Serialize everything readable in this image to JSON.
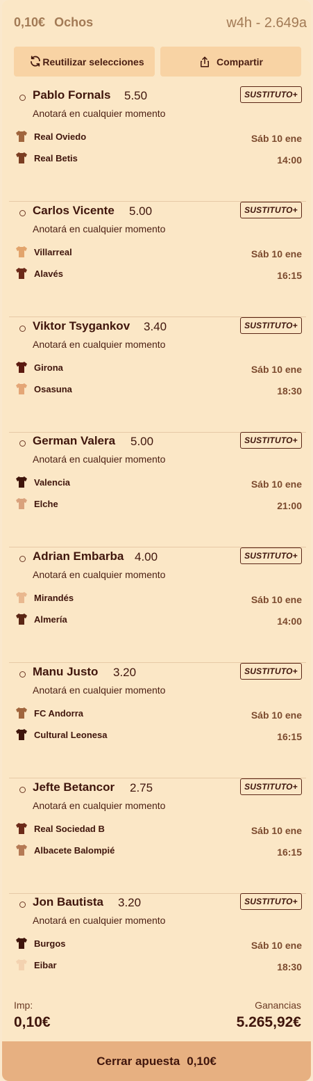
{
  "header": {
    "stake": "0,10€",
    "bet_type": "Ochos",
    "ticket_id": "w4h - 2.649a"
  },
  "actions": {
    "reuse_label": "Reutilizar selecciones",
    "share_label": "Compartir"
  },
  "badge_label": "SUSTITUTO+",
  "legs": [
    {
      "player": "Pablo Fornals",
      "odds": "5.50",
      "market": "Anotará en cualquier momento",
      "home": "Real Oviedo",
      "away": "Real Betis",
      "date": "Sáb 10 ene",
      "time": "14:00"
    },
    {
      "player": "Carlos Vicente",
      "odds": "5.00",
      "market": "Anotará en cualquier momento",
      "home": "Villarreal",
      "away": "Alavés",
      "date": "Sáb 10 ene",
      "time": "16:15"
    },
    {
      "player": "Viktor Tsygankov",
      "odds": "3.40",
      "market": "Anotará en cualquier momento",
      "home": "Girona",
      "away": "Osasuna",
      "date": "Sáb 10 ene",
      "time": "18:30"
    },
    {
      "player": "German Valera",
      "odds": "5.00",
      "market": "Anotará en cualquier momento",
      "home": "Valencia",
      "away": "Elche",
      "date": "Sáb 10 ene",
      "time": "21:00"
    },
    {
      "player": "Adrian Embarba",
      "odds": "4.00",
      "market": "Anotará en cualquier momento",
      "home": "Mirandés",
      "away": "Almería",
      "date": "Sáb 10 ene",
      "time": "14:00"
    },
    {
      "player": "Manu Justo",
      "odds": "3.20",
      "market": "Anotará en cualquier momento",
      "home": "FC Andorra",
      "away": "Cultural Leonesa",
      "date": "Sáb 10 ene",
      "time": "16:15"
    },
    {
      "player": "Jefte Betancor",
      "odds": "2.75",
      "market": "Anotará en cualquier momento",
      "home": "Real Sociedad B",
      "away": "Albacete Balompié",
      "date": "Sáb 10 ene",
      "time": "16:15"
    },
    {
      "player": "Jon Bautista",
      "odds": "3.20",
      "market": "Anotará en cualquier momento",
      "home": "Burgos",
      "away": "Eibar",
      "date": "Sáb 10 ene",
      "time": "18:30"
    }
  ],
  "footer": {
    "imp_label": "Imp:",
    "imp_value": "0,10€",
    "winnings_label": "Ganancias",
    "winnings_value": "5.265,92€",
    "close_label": "Cerrar apuesta",
    "close_amount": "0,10€"
  }
}
